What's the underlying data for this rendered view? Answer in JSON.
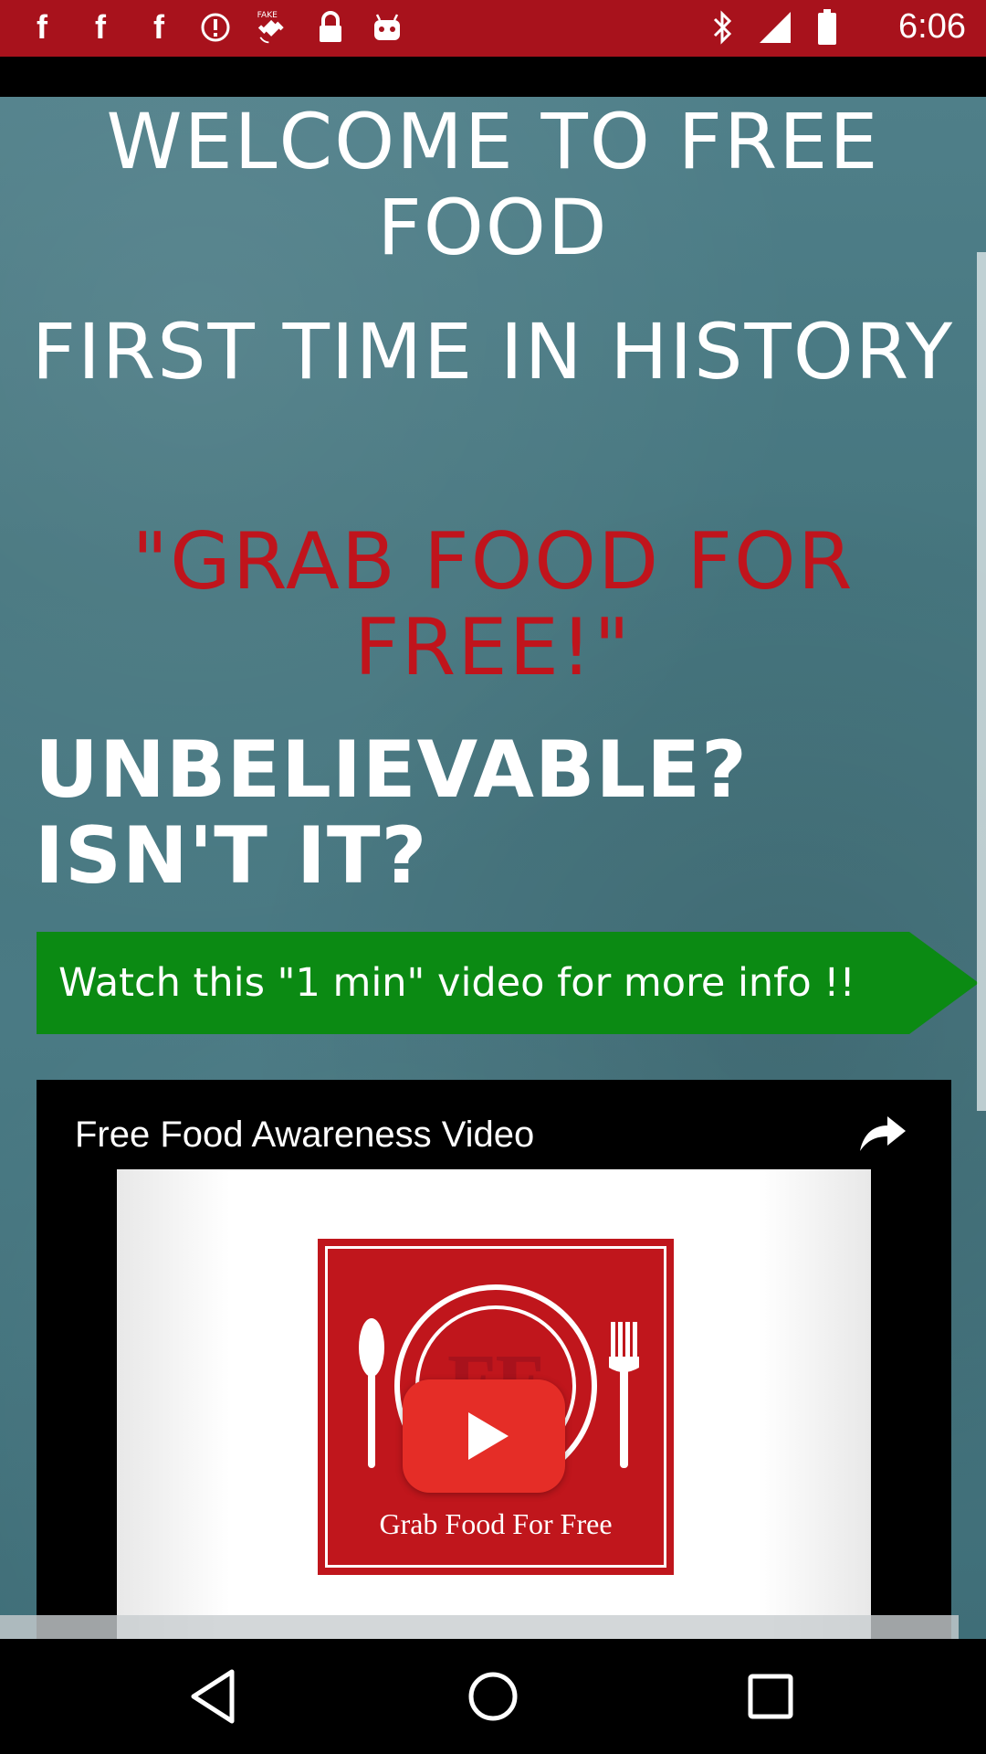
{
  "status_bar": {
    "time": "6:06",
    "left_icons": [
      "facebook-icon",
      "facebook-icon",
      "facebook-icon",
      "alert-icon",
      "fake-gps-icon",
      "lock-icon",
      "android-icon"
    ],
    "fake_label": "FAKE",
    "right_icons": [
      "bluetooth-icon",
      "signal-icon",
      "battery-icon"
    ]
  },
  "main": {
    "welcome_text": "WELCOME TO FREE FOOD",
    "first_time_text": "FIRST TIME IN HISTORY",
    "grab_text": "\"GRAB FOOD FOR FREE!\"",
    "unbelievable_line1": "UNBELIEVABLE?",
    "unbelievable_line2": "ISN'T IT?",
    "banner_text": "Watch this \"1 min\" video for more info !!"
  },
  "video": {
    "title": "Free Food Awareness Video",
    "share_icon": "share-icon",
    "thumbnail_caption": "Grab Food For Free",
    "thumbnail_logo": "FF",
    "play_icon": "play-icon"
  },
  "colors": {
    "status_bar": "#a8121c",
    "headline_red": "#c0141c",
    "banner_green": "#0b8a13",
    "play_red": "#e52d27"
  },
  "nav_bar": {
    "icons": [
      "back-icon",
      "home-icon",
      "recents-icon"
    ]
  }
}
